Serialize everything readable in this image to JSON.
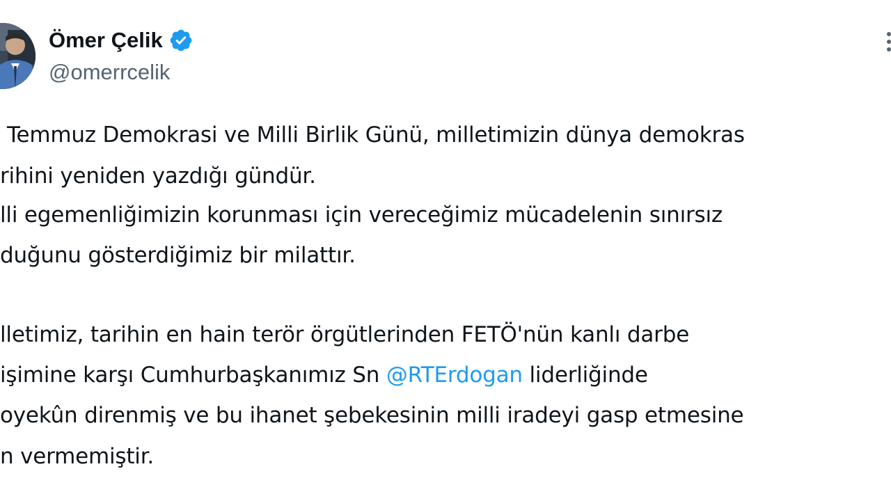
{
  "author": {
    "display_name": "Ömer Çelik",
    "handle": "@omerrcelik",
    "verified_icon": "verified-badge-icon",
    "avatar_icon": "profile-photo"
  },
  "menu": {
    "icon": "more-options-icon"
  },
  "tweet": {
    "paragraph1": {
      "line1": "Temmuz Demokrasi ve Milli Birlik Günü, milletimizin dünya demokras",
      "line2": "rihini yeniden yazdığı gündür.",
      "line3": "lli egemenliğimizin korunması için vereceğimiz mücadelenin sınırsız",
      "line4": "duğunu gösterdiğimiz bir milattır."
    },
    "paragraph2": {
      "line1": "lletimiz, tarihin en hain terör örgütlerinden FETÖ'nün kanlı darbe",
      "line2_before": "işimine karşı Cumhurbaşkanımız Sn ",
      "line2_mention": "@RTErdogan",
      "line2_after": " liderliğinde",
      "line3": "oyekûn direnmiş ve bu ihanet şebekesinin milli iradeyi gasp etmesine",
      "line4": "n vermemiştir."
    }
  },
  "colors": {
    "text": "#0f1419",
    "secondary": "#536471",
    "accent": "#1d9bf0",
    "background": "#ffffff"
  }
}
